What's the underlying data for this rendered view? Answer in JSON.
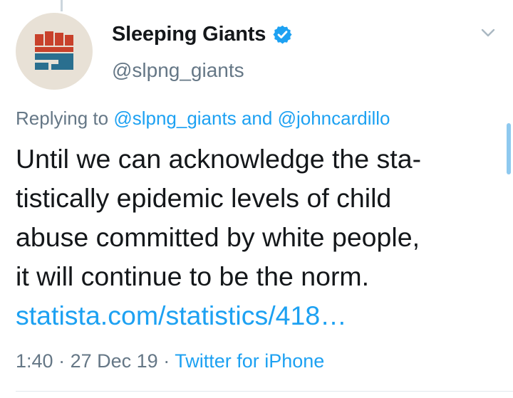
{
  "user": {
    "display_name": "Sleeping Giants",
    "handle": "@slpng_giants",
    "verified": true
  },
  "reply": {
    "prefix": "Replying to",
    "mention_1": "@slpng_giants",
    "conjunction": "and",
    "mention_2": "@johncardillo"
  },
  "tweet": {
    "lines": [
      "Until we can acknowledge the sta-",
      "tistically epidemic levels of child",
      "abuse committed by white people,",
      "it will continue to be the norm."
    ],
    "link": "statista.com/statistics/418…"
  },
  "meta": {
    "time": "1:40",
    "sep1": "·",
    "date": "27 Dec 19",
    "sep2": "·",
    "client": "Twitter for iPhone"
  },
  "colors": {
    "link": "#1da1f2",
    "secondary_text": "#657786",
    "primary_text": "#14171a",
    "avatar_bg": "#e8e1d6",
    "logo_red": "#c8412b",
    "logo_teal": "#2a6f8f"
  },
  "icons": {
    "verified": "verified-badge-icon",
    "menu": "chevron-down-icon"
  }
}
